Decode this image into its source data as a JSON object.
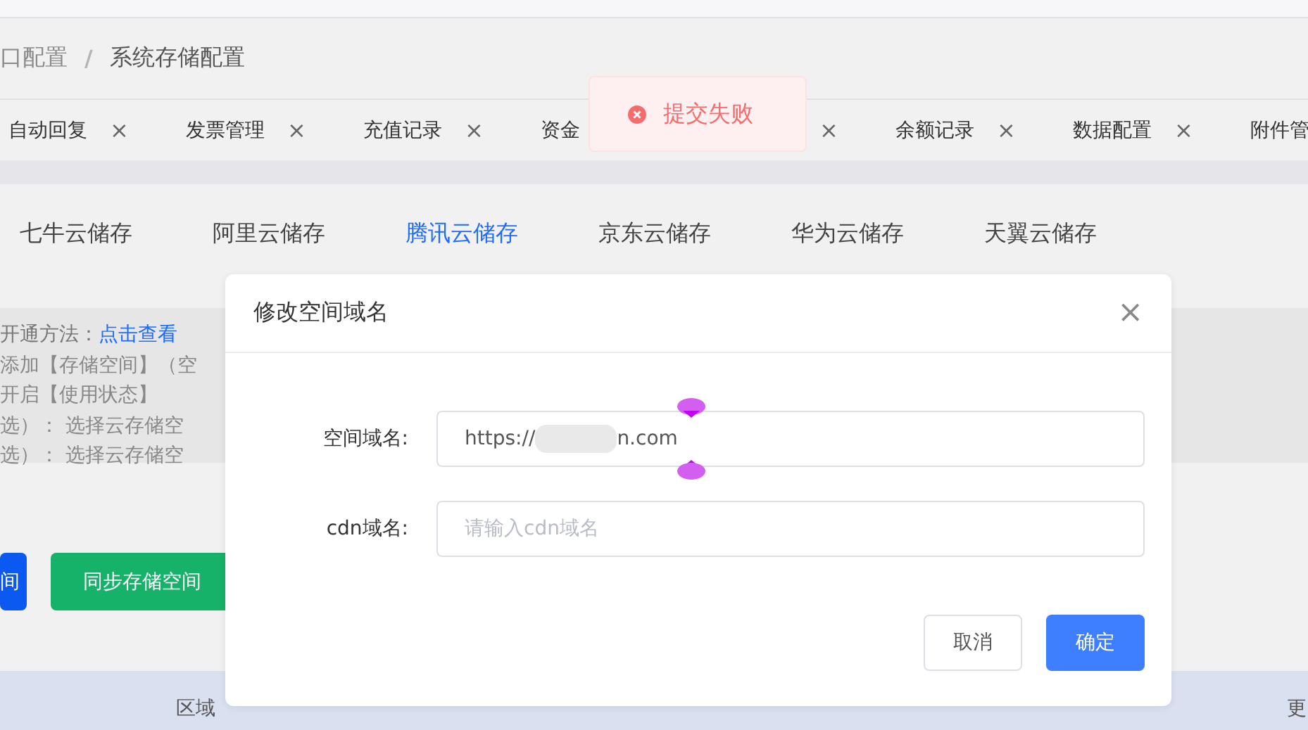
{
  "breadcrumb": [
    {
      "label": "口配置",
      "current": false
    },
    {
      "label": "系统存储配置",
      "current": true
    }
  ],
  "breadcrumb_separator": "/",
  "open_tabs": [
    {
      "label": "自动回复",
      "close": "×"
    },
    {
      "label": "发票管理",
      "close": "×"
    },
    {
      "label": "充值记录",
      "close": "×"
    },
    {
      "label": "资金"
    },
    {
      "close": "×"
    },
    {
      "label": "余额记录",
      "close": "×"
    },
    {
      "label": "数据配置",
      "close": "×"
    },
    {
      "label": "附件管"
    }
  ],
  "toast": {
    "kind": "error",
    "message": "提交失败"
  },
  "storage_tabs": [
    {
      "label": "七牛云储存",
      "selected": false
    },
    {
      "label": "阿里云储存",
      "selected": false
    },
    {
      "label": "腾讯云储存",
      "selected": true
    },
    {
      "label": "京东云储存",
      "selected": false
    },
    {
      "label": "华为云储存",
      "selected": false
    },
    {
      "label": "天翼云储存",
      "selected": false
    }
  ],
  "instructions": {
    "lead": "开通方法：",
    "link": "点击查看",
    "lines": [
      "添加【存储空间】（空",
      "开启【使用状态】",
      "选）：  选择云存储空",
      "选）：  选择云存储空"
    ]
  },
  "actions": [
    {
      "label": "间",
      "kind": "primary"
    },
    {
      "label": "同步存储空间",
      "kind": "success"
    }
  ],
  "table": {
    "columns": [
      "区域",
      "更"
    ]
  },
  "dialog": {
    "title": "修改空间域名",
    "close": "×",
    "fields": [
      {
        "label": "空间域名:",
        "value_start": "https://",
        "value_end": "n.com",
        "blurred": true,
        "selection": true
      },
      {
        "label": "cdn域名:",
        "placeholder": "请输入cdn域名"
      }
    ],
    "buttons": [
      {
        "label": "取消",
        "kind": "default"
      },
      {
        "label": "确定",
        "kind": "primary"
      }
    ]
  }
}
